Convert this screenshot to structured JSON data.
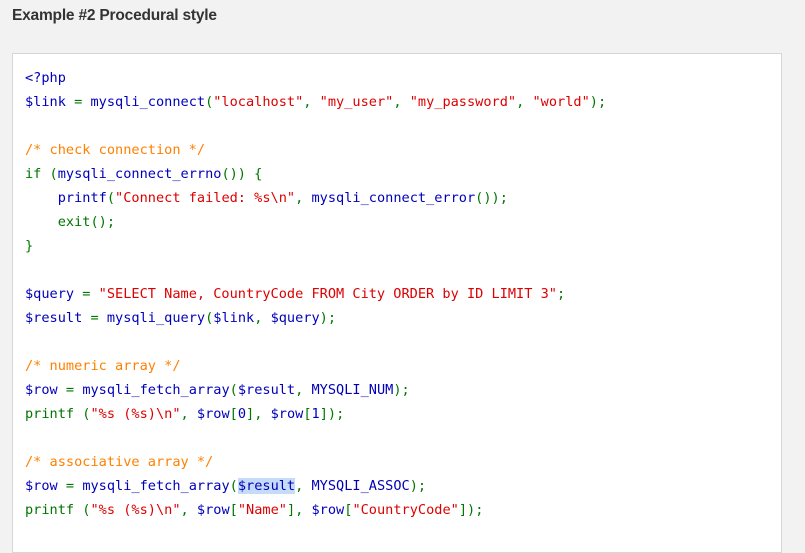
{
  "title": "Example #2 Procedural style",
  "colors": {
    "default": "#0000bb",
    "keyword": "#007700",
    "string": "#dd0000",
    "comment": "#ff8000",
    "highlight": "#c6dbf7"
  },
  "code_lines": [
    [
      [
        "default",
        "<?php"
      ]
    ],
    [
      [
        "default",
        "$link"
      ],
      [
        "keyword",
        " = "
      ],
      [
        "default",
        "mysqli_connect"
      ],
      [
        "keyword",
        "("
      ],
      [
        "string",
        "\"localhost\""
      ],
      [
        "keyword",
        ", "
      ],
      [
        "string",
        "\"my_user\""
      ],
      [
        "keyword",
        ", "
      ],
      [
        "string",
        "\"my_password\""
      ],
      [
        "keyword",
        ", "
      ],
      [
        "string",
        "\"world\""
      ],
      [
        "keyword",
        ");"
      ]
    ],
    [],
    [
      [
        "comment",
        "/* check connection */"
      ]
    ],
    [
      [
        "keyword",
        "if ("
      ],
      [
        "default",
        "mysqli_connect_errno"
      ],
      [
        "keyword",
        "()) {"
      ]
    ],
    [
      [
        "keyword",
        "    "
      ],
      [
        "default",
        "printf"
      ],
      [
        "keyword",
        "("
      ],
      [
        "string",
        "\"Connect failed: %s\\n\""
      ],
      [
        "keyword",
        ", "
      ],
      [
        "default",
        "mysqli_connect_error"
      ],
      [
        "keyword",
        "());"
      ]
    ],
    [
      [
        "keyword",
        "    exit();"
      ]
    ],
    [
      [
        "keyword",
        "}"
      ]
    ],
    [],
    [
      [
        "default",
        "$query"
      ],
      [
        "keyword",
        " = "
      ],
      [
        "string",
        "\"SELECT Name, CountryCode FROM City ORDER by ID LIMIT 3\""
      ],
      [
        "keyword",
        ";"
      ]
    ],
    [
      [
        "default",
        "$result"
      ],
      [
        "keyword",
        " = "
      ],
      [
        "default",
        "mysqli_query"
      ],
      [
        "keyword",
        "("
      ],
      [
        "default",
        "$link"
      ],
      [
        "keyword",
        ", "
      ],
      [
        "default",
        "$query"
      ],
      [
        "keyword",
        ");"
      ]
    ],
    [],
    [
      [
        "comment",
        "/* numeric array */"
      ]
    ],
    [
      [
        "default",
        "$row"
      ],
      [
        "keyword",
        " = "
      ],
      [
        "default",
        "mysqli_fetch_array"
      ],
      [
        "keyword",
        "("
      ],
      [
        "default",
        "$result"
      ],
      [
        "keyword",
        ", "
      ],
      [
        "default",
        "MYSQLI_NUM"
      ],
      [
        "keyword",
        ");"
      ]
    ],
    [
      [
        "keyword",
        "printf ("
      ],
      [
        "string",
        "\"%s (%s)\\n\""
      ],
      [
        "keyword",
        ", "
      ],
      [
        "default",
        "$row"
      ],
      [
        "keyword",
        "["
      ],
      [
        "default",
        "0"
      ],
      [
        "keyword",
        "], "
      ],
      [
        "default",
        "$row"
      ],
      [
        "keyword",
        "["
      ],
      [
        "default",
        "1"
      ],
      [
        "keyword",
        "]);"
      ]
    ],
    [],
    [
      [
        "comment",
        "/* associative array */"
      ]
    ],
    [
      [
        "default",
        "$row"
      ],
      [
        "keyword",
        " = "
      ],
      [
        "default",
        "mysqli_fetch_array"
      ],
      [
        "keyword",
        "("
      ],
      [
        "highlight",
        "$result"
      ],
      [
        "keyword",
        ", "
      ],
      [
        "default",
        "MYSQLI_ASSOC"
      ],
      [
        "keyword",
        ");"
      ]
    ],
    [
      [
        "keyword",
        "printf ("
      ],
      [
        "string",
        "\"%s (%s)\\n\""
      ],
      [
        "keyword",
        ", "
      ],
      [
        "default",
        "$row"
      ],
      [
        "keyword",
        "["
      ],
      [
        "string",
        "\"Name\""
      ],
      [
        "keyword",
        "], "
      ],
      [
        "default",
        "$row"
      ],
      [
        "keyword",
        "["
      ],
      [
        "string",
        "\"CountryCode\""
      ],
      [
        "keyword",
        "]);"
      ]
    ]
  ]
}
